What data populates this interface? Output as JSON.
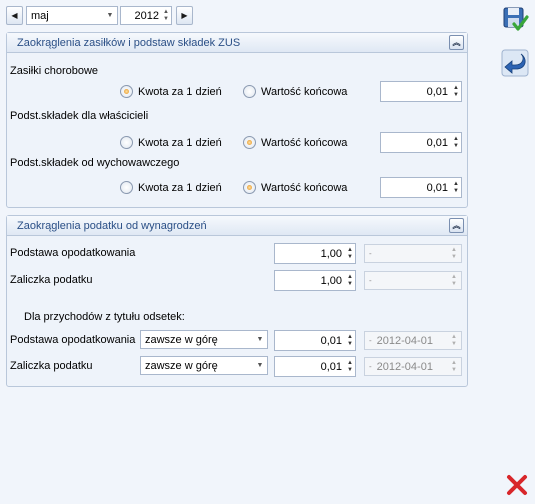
{
  "header": {
    "month": "maj",
    "year": "2012",
    "prev_icon": "arrow-left-icon",
    "next_icon": "arrow-right-icon"
  },
  "zus_section": {
    "title": "Zaokrąglenia zasiłków i podstaw składek ZUS",
    "option_labels": {
      "per_day": "Kwota za 1 dzień",
      "final": "Wartość końcowa"
    },
    "rows": [
      {
        "label": "Zasiłki chorobowe",
        "selected": "per_day",
        "value": "0,01"
      },
      {
        "label": "Podst.składek dla właścicieli",
        "selected": "final",
        "value": "0,01"
      },
      {
        "label": "Podst.składek od wychowawczego",
        "selected": "final",
        "value": "0,01"
      }
    ]
  },
  "tax_section": {
    "title": "Zaokrąglenia podatku od wynagrodzeń",
    "rows": [
      {
        "label": "Podstawa opodatkowania",
        "value": "1,00"
      },
      {
        "label": "Zaliczka podatku",
        "value": "1,00"
      }
    ],
    "interest_heading": "Dla przychodów z tytułu odsetek:",
    "interest_rows": [
      {
        "label": "Podstawa opodatkowania",
        "mode": "zawsze w górę",
        "value": "0,01",
        "date": "2012-04-01"
      },
      {
        "label": "Zaliczka podatku",
        "mode": "zawsze w górę",
        "value": "0,01",
        "date": "2012-04-01"
      }
    ]
  },
  "sidebar": {
    "save_icon": "save-icon",
    "undo_icon": "undo-icon",
    "close_icon": "close-icon"
  },
  "colors": {
    "background": "#f1f5fb",
    "panel_title": "#2a4f86",
    "close_red": "#d8262a",
    "check_green": "#3aa63a"
  }
}
